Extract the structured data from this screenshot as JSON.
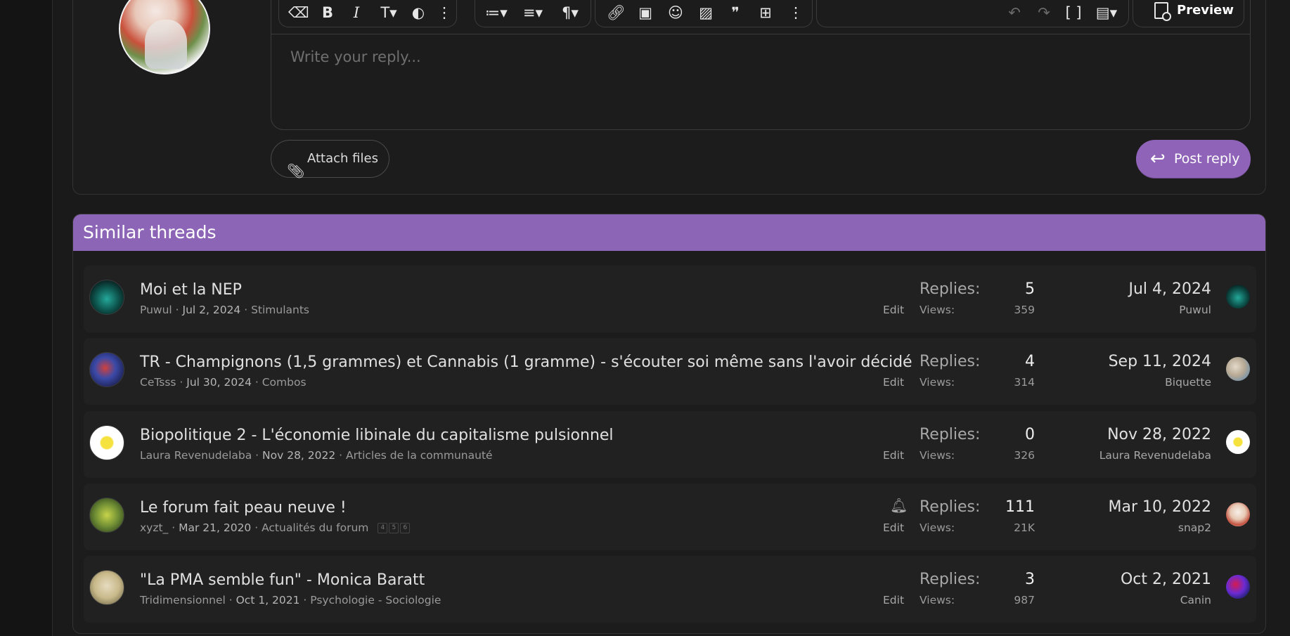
{
  "editor": {
    "placeholder": "Write your reply...",
    "preview_label": "Preview",
    "toolbar_icons": [
      "eraser-icon",
      "bold-icon",
      "italic-icon",
      "text-size-icon",
      "palette-icon",
      "more-icon",
      "list-icon",
      "align-icon",
      "paragraph-icon",
      "link-icon",
      "image-icon",
      "smile-icon",
      "media-icon",
      "quote-icon",
      "table-icon",
      "more-icon",
      "undo-icon",
      "redo-icon",
      "brackets-icon",
      "save-draft-icon"
    ]
  },
  "actions": {
    "attach_label": "Attach files",
    "post_reply_label": "Post reply"
  },
  "similar": {
    "title": "Similar threads",
    "threads": [
      {
        "title": "Moi et la NEP",
        "author": "Puwul",
        "date": "Jul 2, 2024",
        "forum": "Stimulants",
        "edit": "Edit",
        "replies_label": "Replies:",
        "replies": "5",
        "views_label": "Views:",
        "views": "359",
        "last_date": "Jul 4, 2024",
        "last_user": "Puwul"
      },
      {
        "title": "TR - Champignons (1,5 grammes) et Cannabis (1 gramme) - s'écouter soi même sans l'avoir décidé",
        "author": "CeTsss",
        "date": "Jul 30, 2024",
        "forum": "Combos",
        "edit": "Edit",
        "replies_label": "Replies:",
        "replies": "4",
        "views_label": "Views:",
        "views": "314",
        "last_date": "Sep 11, 2024",
        "last_user": "Biquette"
      },
      {
        "title": "Biopolitique 2 - L'économie libinale du capitalisme pulsionnel",
        "author": "Laura Revenudelaba",
        "date": "Nov 28, 2022",
        "forum": "Articles de la communauté",
        "edit": "Edit",
        "replies_label": "Replies:",
        "replies": "0",
        "views_label": "Views:",
        "views": "326",
        "last_date": "Nov 28, 2022",
        "last_user": "Laura Revenudelaba"
      },
      {
        "title": "Le forum fait peau neuve !",
        "author": "xyzt_",
        "date": "Mar 21, 2020",
        "forum": "Actualités du forum",
        "pages": [
          "4",
          "5",
          "6"
        ],
        "edit": "Edit",
        "replies_label": "Replies:",
        "replies": "111",
        "views_label": "Views:",
        "views": "21K",
        "last_date": "Mar 10, 2022",
        "last_user": "snap2"
      },
      {
        "title": "\"La PMA semble fun\" - Monica Baratt",
        "author": "Tridimensionnel",
        "date": "Oct 1, 2021",
        "forum": "Psychologie - Sociologie",
        "edit": "Edit",
        "replies_label": "Replies:",
        "replies": "3",
        "views_label": "Views:",
        "views": "987",
        "last_date": "Oct 2, 2021",
        "last_user": "Canin"
      }
    ]
  }
}
